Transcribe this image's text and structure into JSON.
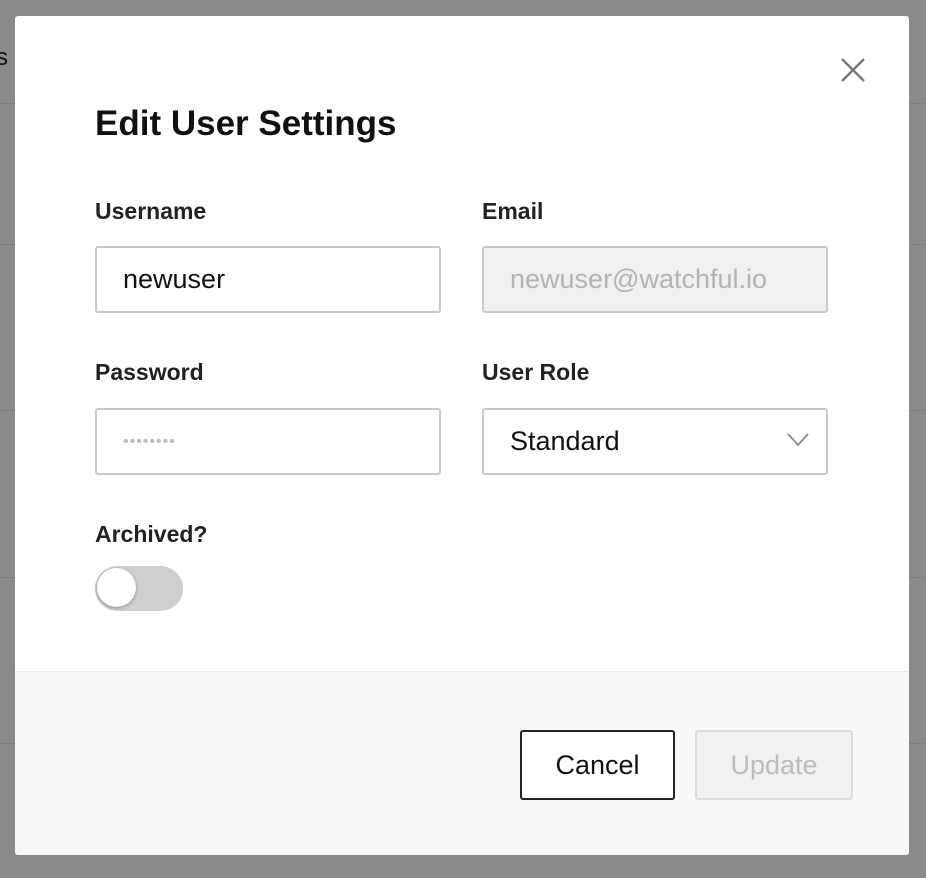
{
  "background": {
    "partial_text": "s"
  },
  "modal": {
    "title": "Edit User Settings",
    "close_icon": "close-icon",
    "fields": {
      "username": {
        "label": "Username",
        "value": "newuser"
      },
      "email": {
        "label": "Email",
        "value": "newuser@watchful.io",
        "disabled": true
      },
      "password": {
        "label": "Password",
        "value": "••••••••"
      },
      "role": {
        "label": "User Role",
        "value": "Standard",
        "icon": "chevron-down-icon"
      },
      "archived": {
        "label": "Archived?",
        "checked": false
      }
    },
    "footer": {
      "cancel_label": "Cancel",
      "update_label": "Update",
      "update_disabled": true
    }
  },
  "colors": {
    "overlay": "#8a8a8a",
    "toggle_off": "#cfcfcf",
    "disabled_text": "#bcbcbc"
  }
}
